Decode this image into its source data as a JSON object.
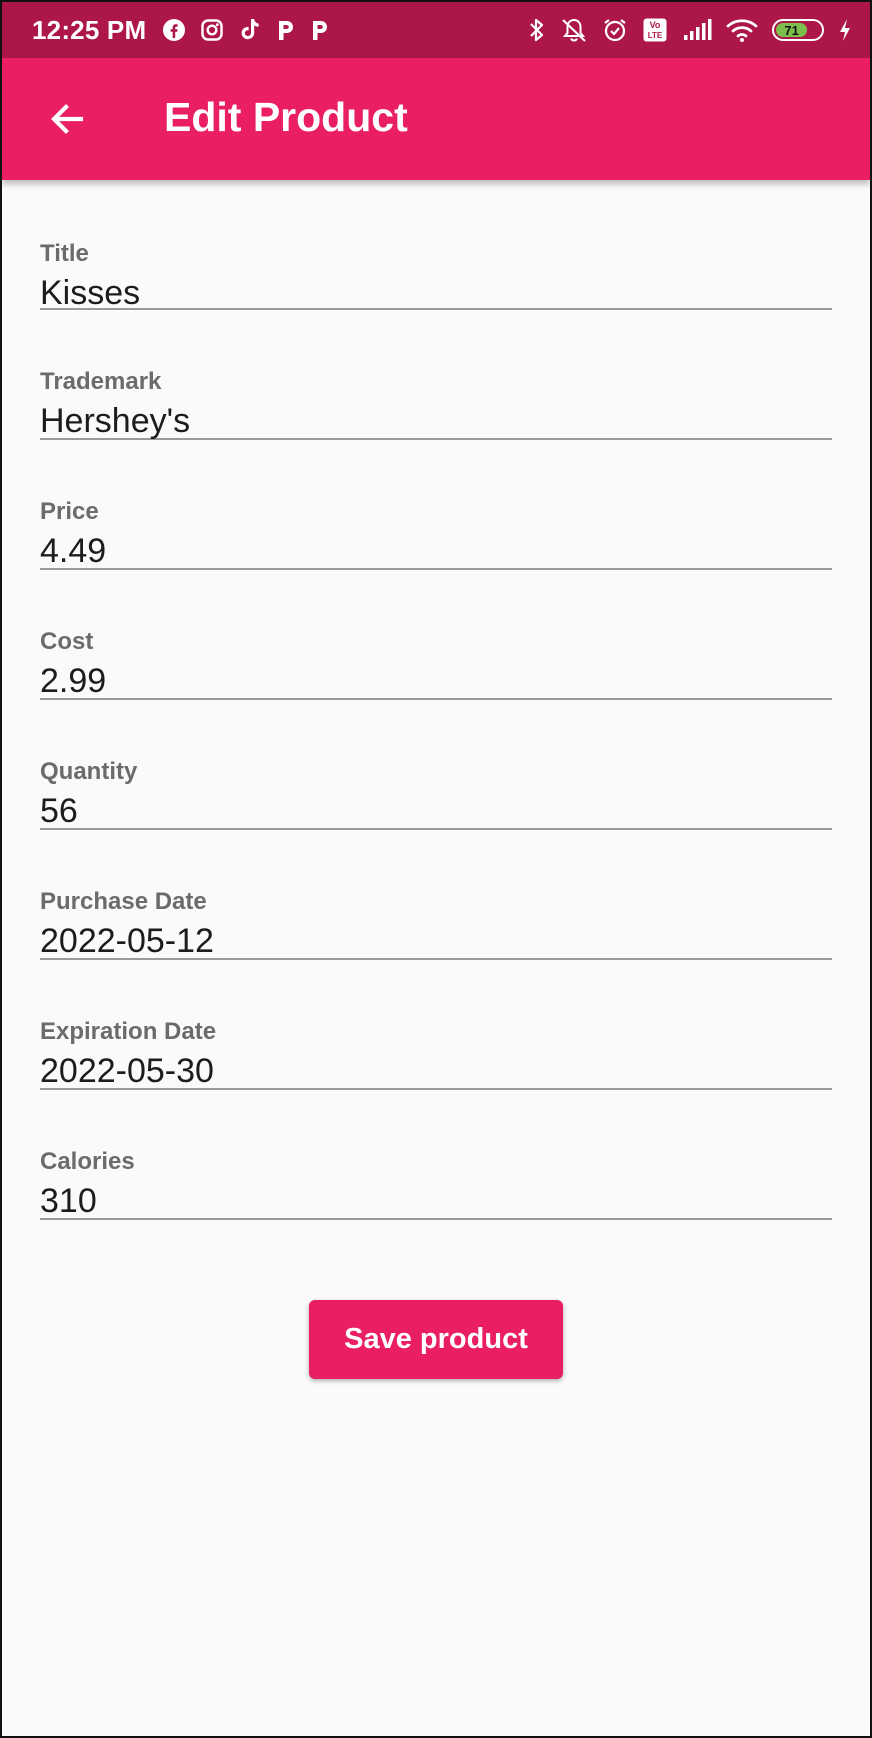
{
  "status_bar": {
    "time": "12:25 PM",
    "left_icons": [
      "facebook-icon",
      "instagram-icon",
      "tiktok-icon",
      "p-app-icon",
      "p-app-icon"
    ],
    "right_icons": [
      "bluetooth-icon",
      "vibrate-off-icon",
      "alarm-icon",
      "volte-icon",
      "signal-icon",
      "wifi-icon",
      "battery-icon",
      "charging-icon"
    ],
    "volte_label": "Vo LTE",
    "battery_level": "71",
    "battery_fraction": 0.71,
    "battery_color": "#7cc04b"
  },
  "app_bar": {
    "title": "Edit Product",
    "color": "#e91e63",
    "back_icon": "arrow-left-icon"
  },
  "form": {
    "fields": [
      {
        "label": "Title",
        "value": "Kisses"
      },
      {
        "label": "Trademark",
        "value": "Hershey's"
      },
      {
        "label": "Price",
        "value": "4.49"
      },
      {
        "label": "Cost",
        "value": "2.99"
      },
      {
        "label": "Quantity",
        "value": "56"
      },
      {
        "label": "Purchase Date",
        "value": "2022-05-12"
      },
      {
        "label": "Expiration Date",
        "value": "2022-05-30"
      },
      {
        "label": "Calories",
        "value": "310"
      }
    ]
  },
  "actions": {
    "save_label": "Save product",
    "save_color": "#e91e63"
  }
}
